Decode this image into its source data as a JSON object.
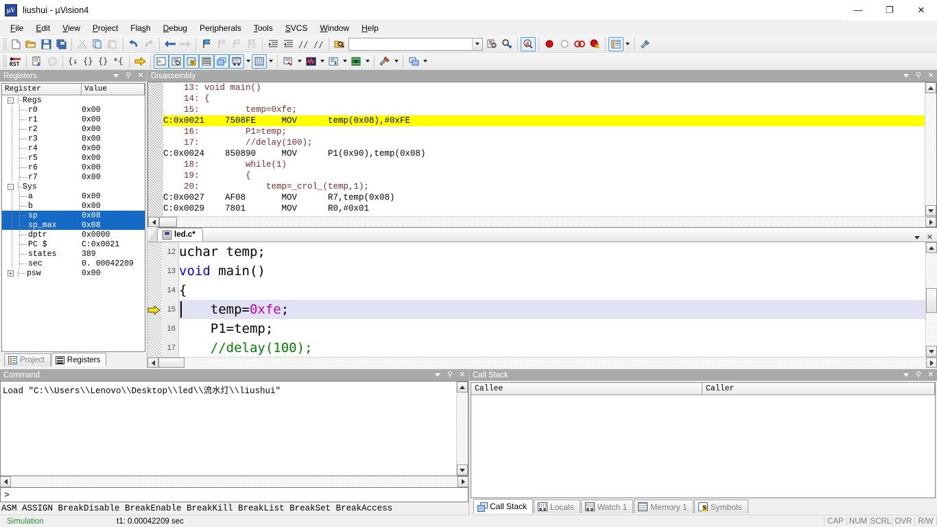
{
  "window": {
    "title": "liushui  - µVision4",
    "app_icon": "uvision-icon",
    "minimize": "—",
    "maximize": "❐",
    "close": "✕"
  },
  "menubar": {
    "items": [
      {
        "label": "File",
        "accel": "F"
      },
      {
        "label": "Edit",
        "accel": "E"
      },
      {
        "label": "View",
        "accel": "V"
      },
      {
        "label": "Project",
        "accel": "P"
      },
      {
        "label": "Flash",
        "accel": "s"
      },
      {
        "label": "Debug",
        "accel": "D"
      },
      {
        "label": "Peripherals",
        "accel": "i"
      },
      {
        "label": "Tools",
        "accel": "T"
      },
      {
        "label": "SVCS",
        "accel": "S"
      },
      {
        "label": "Window",
        "accel": "W"
      },
      {
        "label": "Help",
        "accel": "H"
      }
    ]
  },
  "toolbar_main": {
    "search_value": "",
    "buttons": [
      "new-file-icon",
      "open-file-icon",
      "save-icon",
      "save-all-icon",
      "cut-icon",
      "copy-icon",
      "paste-icon",
      "undo-icon",
      "redo-icon",
      "navigate-back-icon",
      "navigate-forward-icon",
      "bookmark-toggle-icon",
      "bookmark-prev-icon",
      "bookmark-next-icon",
      "bookmark-clear-icon",
      "indent-icon",
      "outdent-icon",
      "comment-icon",
      "uncomment-icon",
      "open-project-icon",
      "find-in-files-icon",
      "find-icon",
      "debug-session-icon",
      "insert-breakpoint-icon",
      "enable-breakpoint-icon",
      "disable-all-breakpoints-icon",
      "kill-all-breakpoints-icon",
      "window-layout-icon",
      "configuration-wizard-icon"
    ]
  },
  "toolbar_debug": {
    "buttons": [
      "reset-cpu-icon",
      "run-icon",
      "stop-icon",
      "step-into-icon",
      "step-over-icon",
      "step-out-icon",
      "run-to-cursor-icon",
      "show-next-statement-icon",
      "command-window-icon",
      "disassembly-window-icon",
      "symbols-window-icon",
      "registers-window-icon",
      "call-stack-window-icon",
      "watch-window-icon",
      "memory-window-icon",
      "serial-window-icon",
      "analysis-window-icon",
      "trace-window-icon",
      "system-viewer-icon",
      "toolbox-icon",
      "debug-restore-views-icon"
    ]
  },
  "registers_panel": {
    "title": "Registers",
    "columns": [
      "Register",
      "Value"
    ],
    "rows": [
      {
        "name": "Regs",
        "value": "",
        "level": 0,
        "expander": "-",
        "selected": false
      },
      {
        "name": "r0",
        "value": "0x00",
        "level": 1,
        "expander": "",
        "selected": false
      },
      {
        "name": "r1",
        "value": "0x00",
        "level": 1,
        "expander": "",
        "selected": false
      },
      {
        "name": "r2",
        "value": "0x00",
        "level": 1,
        "expander": "",
        "selected": false
      },
      {
        "name": "r3",
        "value": "0x00",
        "level": 1,
        "expander": "",
        "selected": false
      },
      {
        "name": "r4",
        "value": "0x00",
        "level": 1,
        "expander": "",
        "selected": false
      },
      {
        "name": "r5",
        "value": "0x00",
        "level": 1,
        "expander": "",
        "selected": false
      },
      {
        "name": "r6",
        "value": "0x00",
        "level": 1,
        "expander": "",
        "selected": false
      },
      {
        "name": "r7",
        "value": "0x00",
        "level": 1,
        "expander": "",
        "selected": false
      },
      {
        "name": "Sys",
        "value": "",
        "level": 0,
        "expander": "-",
        "selected": false
      },
      {
        "name": "a",
        "value": "0x00",
        "level": 1,
        "expander": "",
        "selected": false
      },
      {
        "name": "b",
        "value": "0x00",
        "level": 1,
        "expander": "",
        "selected": false
      },
      {
        "name": "sp",
        "value": "0x08",
        "level": 1,
        "expander": "",
        "selected": true
      },
      {
        "name": "sp_max",
        "value": "0x08",
        "level": 1,
        "expander": "",
        "selected": true
      },
      {
        "name": "dptr",
        "value": "0x0000",
        "level": 1,
        "expander": "",
        "selected": false
      },
      {
        "name": "PC  $",
        "value": "C:0x0021",
        "level": 1,
        "expander": "",
        "selected": false
      },
      {
        "name": "states",
        "value": "389",
        "level": 1,
        "expander": "",
        "selected": false
      },
      {
        "name": "sec",
        "value": "0. 00042209",
        "level": 1,
        "expander": "",
        "selected": false
      },
      {
        "name": "psw",
        "value": "0x00",
        "level": 1,
        "expander": "+",
        "selected": false
      }
    ],
    "tabs": [
      {
        "label": "Project",
        "icon": "project-icon",
        "active": false
      },
      {
        "label": "Registers",
        "icon": "registers-icon",
        "active": true
      }
    ]
  },
  "disassembly_panel": {
    "title": "Disassembly",
    "lines": [
      {
        "kind": "src",
        "text": "    13: void main()",
        "highlighted": false,
        "marker": false
      },
      {
        "kind": "src",
        "text": "    14: {",
        "highlighted": false,
        "marker": false
      },
      {
        "kind": "src",
        "text": "    15:         temp=0xfe;",
        "highlighted": false,
        "marker": false
      },
      {
        "kind": "asm",
        "text": "C:0x0021    7508FE     MOV      temp(0x08),#0xFE",
        "highlighted": true,
        "marker": true
      },
      {
        "kind": "src",
        "text": "    16:         P1=temp;",
        "highlighted": false,
        "marker": false
      },
      {
        "kind": "src",
        "text": "    17:         //delay(100);",
        "highlighted": false,
        "marker": false
      },
      {
        "kind": "asm",
        "text": "C:0x0024    850890     MOV      P1(0x90),temp(0x08)",
        "highlighted": false,
        "marker": false
      },
      {
        "kind": "src",
        "text": "    18:         while(1)",
        "highlighted": false,
        "marker": false
      },
      {
        "kind": "src",
        "text": "    19:         {",
        "highlighted": false,
        "marker": false
      },
      {
        "kind": "src",
        "text": "    20:             temp=_crol_(temp,1);",
        "highlighted": false,
        "marker": false
      },
      {
        "kind": "asm",
        "text": "C:0x0027    AF08       MOV      R7,temp(0x08)",
        "highlighted": false,
        "marker": false
      },
      {
        "kind": "asm",
        "text": "C:0x0029    7801       MOV      R0,#0x01",
        "highlighted": false,
        "marker": false
      }
    ]
  },
  "editor_panel": {
    "tab": {
      "label": "led.c*",
      "icon": "c-file-icon"
    },
    "lines": [
      {
        "number": "12",
        "current": false,
        "tokens": [
          {
            "t": "uchar temp;",
            "c": "plain"
          }
        ]
      },
      {
        "number": "13",
        "current": false,
        "tokens": [
          {
            "t": "void ",
            "c": "kw"
          },
          {
            "t": "main()",
            "c": "plain"
          }
        ]
      },
      {
        "number": "14",
        "current": false,
        "tokens": [
          {
            "t": "{",
            "c": "plain"
          }
        ]
      },
      {
        "number": "15",
        "current": true,
        "tokens": [
          {
            "t": "    temp=",
            "c": "plain"
          },
          {
            "t": "0xfe",
            "c": "num"
          },
          {
            "t": ";",
            "c": "plain"
          }
        ]
      },
      {
        "number": "16",
        "current": false,
        "tokens": [
          {
            "t": "    P1=temp;",
            "c": "plain"
          }
        ]
      },
      {
        "number": "17",
        "current": false,
        "tokens": [
          {
            "t": "    //delay(100);",
            "c": "cmt"
          }
        ]
      }
    ]
  },
  "command_panel": {
    "title": "Command",
    "output": "Load \"C:\\\\Users\\\\Lenovo\\\\Desktop\\\\led\\\\流水灯\\\\liushui\"",
    "prompt": ">",
    "input_value": "",
    "keywords": "ASM ASSIGN BreakDisable BreakEnable BreakKill BreakList BreakSet BreakAccess"
  },
  "callstack_panel": {
    "title": "Call Stack",
    "columns": [
      "Callee",
      "Caller"
    ],
    "rows": [],
    "tabs": [
      {
        "label": "Call Stack",
        "icon": "call-stack-icon",
        "active": true
      },
      {
        "label": "Locals",
        "icon": "locals-icon",
        "active": false
      },
      {
        "label": "Watch 1",
        "icon": "watch-icon",
        "active": false
      },
      {
        "label": "Memory 1",
        "icon": "memory-icon",
        "active": false
      },
      {
        "label": "Symbols",
        "icon": "symbols-icon",
        "active": false
      }
    ]
  },
  "statusbar": {
    "simulation": "Simulation",
    "time": "t1: 0.00042209 sec",
    "indicators": [
      "CAP",
      "NUM",
      "SCRL",
      "OVR",
      "R/W"
    ]
  },
  "colors": {
    "highlight_line": "#ffff00",
    "selection": "#1569c7",
    "current_line": "#e2e2f5",
    "panel_title_bg": "#a9a9a9",
    "simulation_green": "#2e8b2e",
    "keyword_blue": "#0000ff",
    "number_magenta": "#bb00bb",
    "asm_source_red": "#7b2b2b"
  }
}
